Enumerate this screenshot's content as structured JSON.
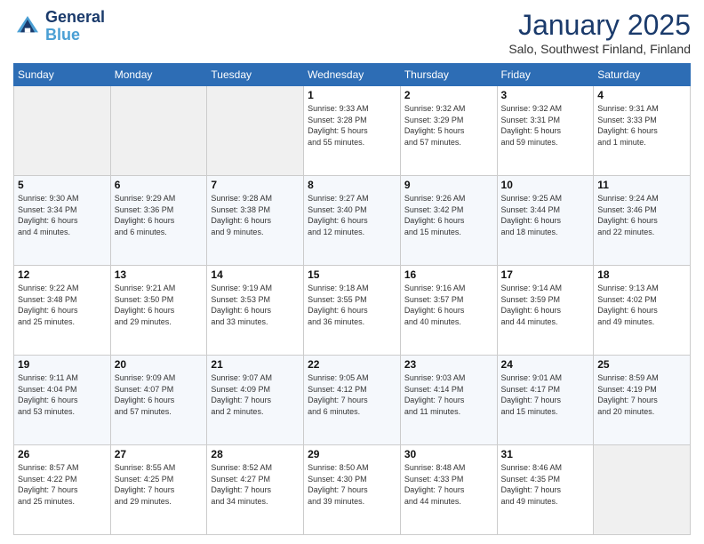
{
  "header": {
    "logo_line1": "General",
    "logo_line2": "Blue",
    "month": "January 2025",
    "location": "Salo, Southwest Finland, Finland"
  },
  "days_of_week": [
    "Sunday",
    "Monday",
    "Tuesday",
    "Wednesday",
    "Thursday",
    "Friday",
    "Saturday"
  ],
  "weeks": [
    [
      {
        "num": "",
        "info": ""
      },
      {
        "num": "",
        "info": ""
      },
      {
        "num": "",
        "info": ""
      },
      {
        "num": "1",
        "info": "Sunrise: 9:33 AM\nSunset: 3:28 PM\nDaylight: 5 hours\nand 55 minutes."
      },
      {
        "num": "2",
        "info": "Sunrise: 9:32 AM\nSunset: 3:29 PM\nDaylight: 5 hours\nand 57 minutes."
      },
      {
        "num": "3",
        "info": "Sunrise: 9:32 AM\nSunset: 3:31 PM\nDaylight: 5 hours\nand 59 minutes."
      },
      {
        "num": "4",
        "info": "Sunrise: 9:31 AM\nSunset: 3:33 PM\nDaylight: 6 hours\nand 1 minute."
      }
    ],
    [
      {
        "num": "5",
        "info": "Sunrise: 9:30 AM\nSunset: 3:34 PM\nDaylight: 6 hours\nand 4 minutes."
      },
      {
        "num": "6",
        "info": "Sunrise: 9:29 AM\nSunset: 3:36 PM\nDaylight: 6 hours\nand 6 minutes."
      },
      {
        "num": "7",
        "info": "Sunrise: 9:28 AM\nSunset: 3:38 PM\nDaylight: 6 hours\nand 9 minutes."
      },
      {
        "num": "8",
        "info": "Sunrise: 9:27 AM\nSunset: 3:40 PM\nDaylight: 6 hours\nand 12 minutes."
      },
      {
        "num": "9",
        "info": "Sunrise: 9:26 AM\nSunset: 3:42 PM\nDaylight: 6 hours\nand 15 minutes."
      },
      {
        "num": "10",
        "info": "Sunrise: 9:25 AM\nSunset: 3:44 PM\nDaylight: 6 hours\nand 18 minutes."
      },
      {
        "num": "11",
        "info": "Sunrise: 9:24 AM\nSunset: 3:46 PM\nDaylight: 6 hours\nand 22 minutes."
      }
    ],
    [
      {
        "num": "12",
        "info": "Sunrise: 9:22 AM\nSunset: 3:48 PM\nDaylight: 6 hours\nand 25 minutes."
      },
      {
        "num": "13",
        "info": "Sunrise: 9:21 AM\nSunset: 3:50 PM\nDaylight: 6 hours\nand 29 minutes."
      },
      {
        "num": "14",
        "info": "Sunrise: 9:19 AM\nSunset: 3:53 PM\nDaylight: 6 hours\nand 33 minutes."
      },
      {
        "num": "15",
        "info": "Sunrise: 9:18 AM\nSunset: 3:55 PM\nDaylight: 6 hours\nand 36 minutes."
      },
      {
        "num": "16",
        "info": "Sunrise: 9:16 AM\nSunset: 3:57 PM\nDaylight: 6 hours\nand 40 minutes."
      },
      {
        "num": "17",
        "info": "Sunrise: 9:14 AM\nSunset: 3:59 PM\nDaylight: 6 hours\nand 44 minutes."
      },
      {
        "num": "18",
        "info": "Sunrise: 9:13 AM\nSunset: 4:02 PM\nDaylight: 6 hours\nand 49 minutes."
      }
    ],
    [
      {
        "num": "19",
        "info": "Sunrise: 9:11 AM\nSunset: 4:04 PM\nDaylight: 6 hours\nand 53 minutes."
      },
      {
        "num": "20",
        "info": "Sunrise: 9:09 AM\nSunset: 4:07 PM\nDaylight: 6 hours\nand 57 minutes."
      },
      {
        "num": "21",
        "info": "Sunrise: 9:07 AM\nSunset: 4:09 PM\nDaylight: 7 hours\nand 2 minutes."
      },
      {
        "num": "22",
        "info": "Sunrise: 9:05 AM\nSunset: 4:12 PM\nDaylight: 7 hours\nand 6 minutes."
      },
      {
        "num": "23",
        "info": "Sunrise: 9:03 AM\nSunset: 4:14 PM\nDaylight: 7 hours\nand 11 minutes."
      },
      {
        "num": "24",
        "info": "Sunrise: 9:01 AM\nSunset: 4:17 PM\nDaylight: 7 hours\nand 15 minutes."
      },
      {
        "num": "25",
        "info": "Sunrise: 8:59 AM\nSunset: 4:19 PM\nDaylight: 7 hours\nand 20 minutes."
      }
    ],
    [
      {
        "num": "26",
        "info": "Sunrise: 8:57 AM\nSunset: 4:22 PM\nDaylight: 7 hours\nand 25 minutes."
      },
      {
        "num": "27",
        "info": "Sunrise: 8:55 AM\nSunset: 4:25 PM\nDaylight: 7 hours\nand 29 minutes."
      },
      {
        "num": "28",
        "info": "Sunrise: 8:52 AM\nSunset: 4:27 PM\nDaylight: 7 hours\nand 34 minutes."
      },
      {
        "num": "29",
        "info": "Sunrise: 8:50 AM\nSunset: 4:30 PM\nDaylight: 7 hours\nand 39 minutes."
      },
      {
        "num": "30",
        "info": "Sunrise: 8:48 AM\nSunset: 4:33 PM\nDaylight: 7 hours\nand 44 minutes."
      },
      {
        "num": "31",
        "info": "Sunrise: 8:46 AM\nSunset: 4:35 PM\nDaylight: 7 hours\nand 49 minutes."
      },
      {
        "num": "",
        "info": ""
      }
    ]
  ]
}
